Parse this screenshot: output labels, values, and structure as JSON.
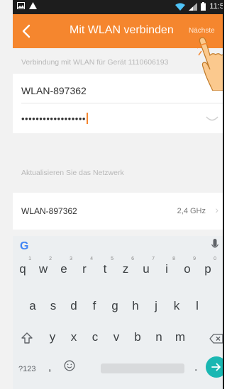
{
  "status_bar": {
    "time": "11:5"
  },
  "header": {
    "title": "Mit WLAN verbinden",
    "next_label": "Nächste",
    "accent_color": "#f5862e"
  },
  "form": {
    "section_label": "Verbindung mit WLAN für Gerät 1110606193",
    "ssid_value": "WLAN-897362",
    "password_mask": "••••••••••••••••••"
  },
  "networks": {
    "section_label": "Aktualisieren Sie das Netzwerk",
    "items": [
      {
        "name": "WLAN-897362",
        "band": "2,4 GHz"
      }
    ]
  },
  "keyboard": {
    "logo": "G",
    "row1": [
      "q",
      "w",
      "e",
      "r",
      "t",
      "z",
      "u",
      "i",
      "o",
      "p"
    ],
    "row1_hints": [
      "1",
      "2",
      "3",
      "4",
      "5",
      "6",
      "7",
      "8",
      "9",
      "0"
    ],
    "row2": [
      "a",
      "s",
      "d",
      "f",
      "g",
      "h",
      "j",
      "k",
      "l"
    ],
    "row3": [
      "y",
      "x",
      "c",
      "v",
      "b",
      "n",
      "m"
    ],
    "symbols_label": "?123",
    "comma": ",",
    "period": ".",
    "enter_color": "#1ab7b2"
  },
  "icons": [
    "back-arrow-icon",
    "wifi-icon",
    "signal-icon",
    "battery-icon",
    "image-icon",
    "warning-icon",
    "eye-icon",
    "chevron-right-icon",
    "mic-icon",
    "shift-icon",
    "backspace-icon",
    "emoji-icon",
    "enter-arrow-icon",
    "hand-pointer-icon"
  ]
}
